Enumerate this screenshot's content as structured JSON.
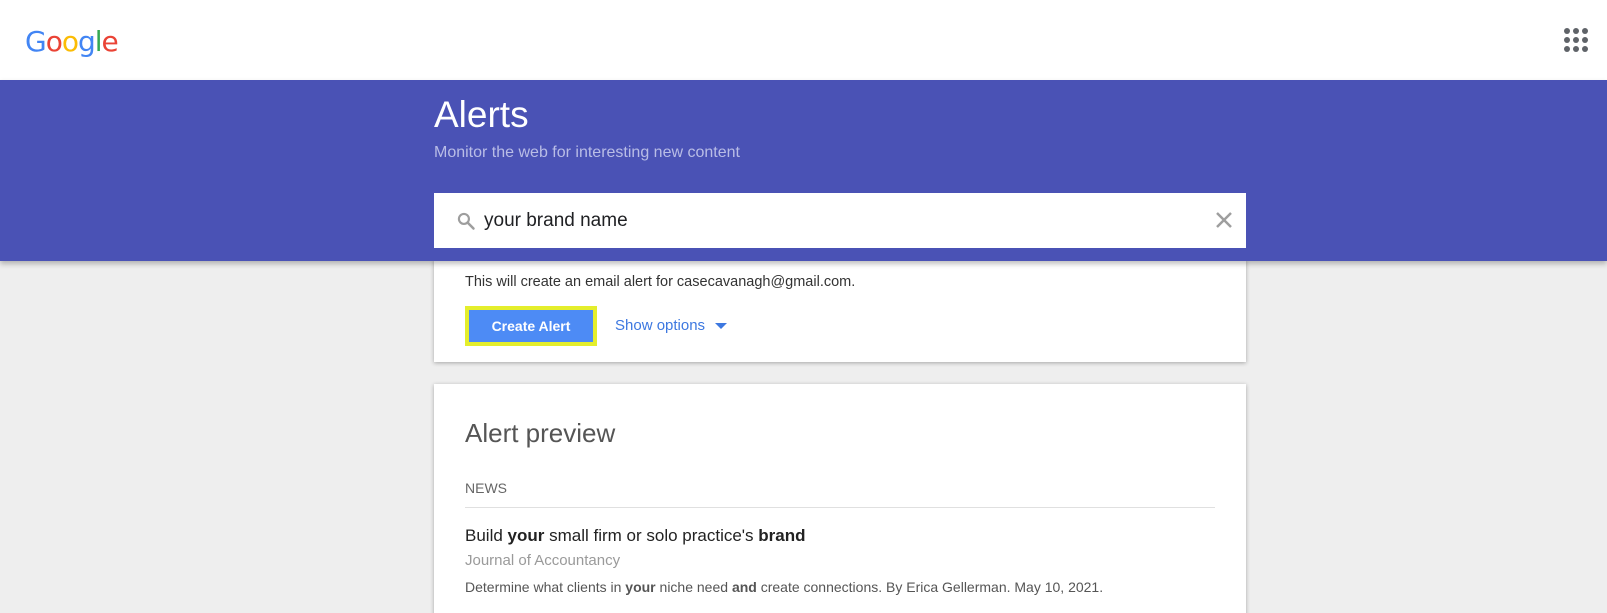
{
  "header": {
    "logo_letters": [
      {
        "char": "G",
        "color": "#4285f4"
      },
      {
        "char": "o",
        "color": "#ea4335"
      },
      {
        "char": "o",
        "color": "#fbbc05"
      },
      {
        "char": "g",
        "color": "#4285f4"
      },
      {
        "char": "l",
        "color": "#34a853"
      },
      {
        "char": "e",
        "color": "#ea4335"
      }
    ],
    "apps_icon": "apps-grid-icon"
  },
  "hero": {
    "title": "Alerts",
    "subtitle": "Monitor the web for interesting new content",
    "background_color": "#4a52b5"
  },
  "search": {
    "value": "your brand name",
    "icon": "search-icon",
    "clear_icon": "close-icon"
  },
  "create_card": {
    "note": "This will create an email alert for casecavanagh@gmail.com.",
    "create_button_label": "Create Alert",
    "show_options_label": "Show options",
    "button_color": "#4d8bf5",
    "highlight_color": "#e4ee2c"
  },
  "preview": {
    "title": "Alert preview",
    "section_label": "NEWS",
    "result": {
      "title_parts": [
        {
          "text": "Build ",
          "bold": false
        },
        {
          "text": "your",
          "bold": true
        },
        {
          "text": " small firm or solo practice's ",
          "bold": false
        },
        {
          "text": "brand",
          "bold": true
        }
      ],
      "source": "Journal of Accountancy",
      "snippet_parts": [
        {
          "text": "Determine what clients in ",
          "bold": false
        },
        {
          "text": "your",
          "bold": true
        },
        {
          "text": " niche need ",
          "bold": false
        },
        {
          "text": "and",
          "bold": true
        },
        {
          "text": " create connections. By Erica Gellerman. May 10, 2021.",
          "bold": false
        }
      ]
    }
  }
}
